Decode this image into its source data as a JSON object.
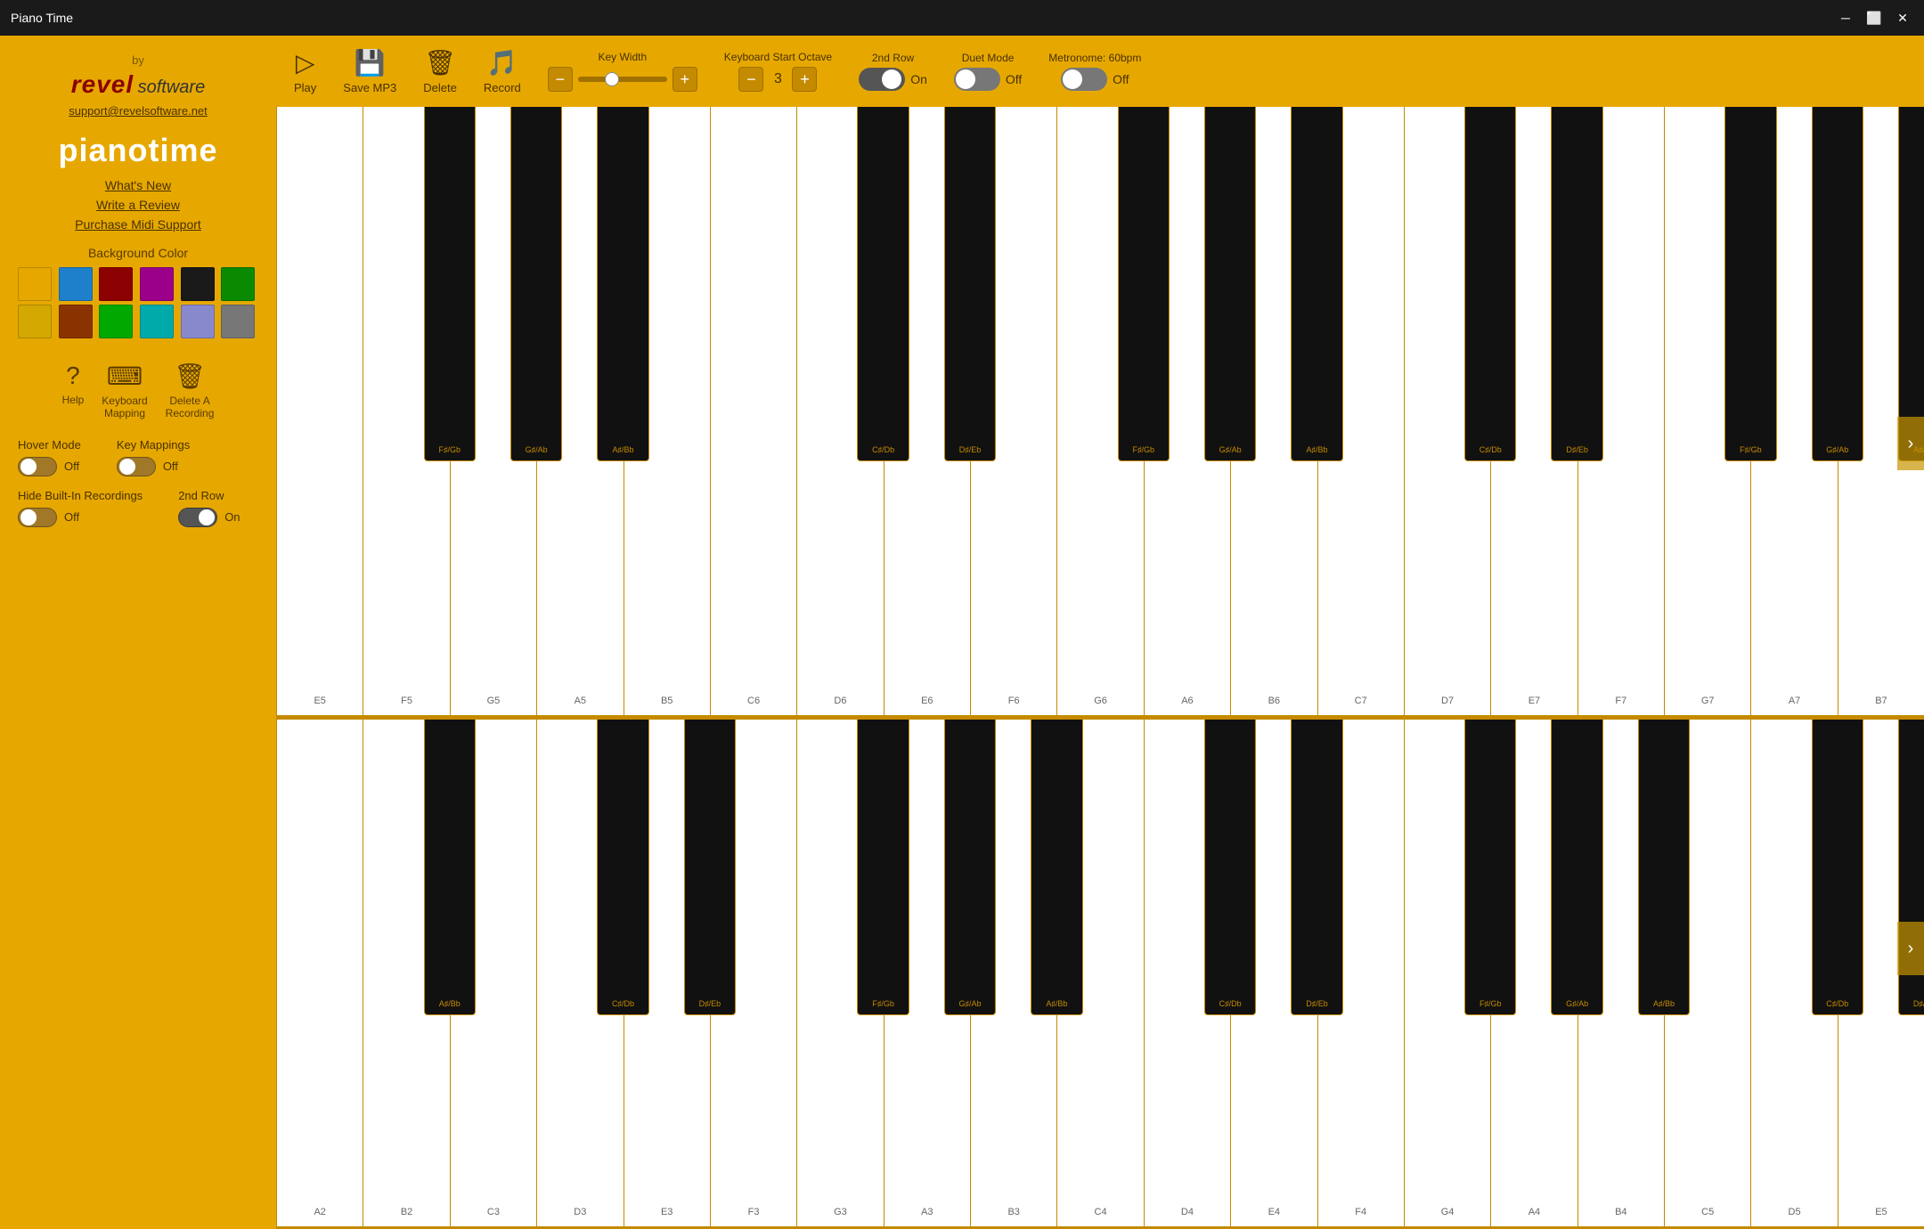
{
  "titleBar": {
    "title": "Piano Time",
    "minimizeLabel": "─",
    "maximizeLabel": "⬜",
    "closeLabel": "✕"
  },
  "sidebar": {
    "appTitle": "pianotime",
    "byLabel": "by",
    "revelLogo": "revel",
    "softwareLabel": "software",
    "email": "support@revelsoftware.net",
    "links": [
      {
        "label": "What's New"
      },
      {
        "label": "Write a Review"
      },
      {
        "label": "Purchase Midi Support"
      }
    ],
    "bgColorLabel": "Background Color",
    "colors": [
      "#E6A800",
      "#1E7FCB",
      "#8B0000",
      "#9B008B",
      "#1a1a1a",
      "#0a8a00",
      "#D4A800",
      "#8B3300",
      "#00A800",
      "#00AAAA",
      "#8888CC",
      "#777777"
    ],
    "helpLabel": "Help",
    "keyboardMappingLabel": "Keyboard\nMapping",
    "deleteRecordingLabel": "Delete A\nRecording",
    "hoverModeLabel": "Hover Mode",
    "hoverModeState": "Off",
    "hoverModeOn": false,
    "keyMappingsLabel": "Key Mappings",
    "keyMappingsState": "Off",
    "keyMappingsOn": false,
    "hideBuiltInLabel": "Hide Built-In Recordings",
    "hideBuiltInState": "Off",
    "hideBuiltInOn": false,
    "secondRowLabel": "2nd Row",
    "secondRowState": "On",
    "secondRowOn": true
  },
  "toolbar": {
    "playLabel": "Play",
    "saveMp3Label": "Save MP3",
    "deleteLabel": "Delete",
    "recordLabel": "Record",
    "keyWidthLabel": "Key Width",
    "keyboardStartOctaveLabel": "Keyboard Start Octave",
    "octaveValue": "3",
    "secondRowLabel": "2nd Row",
    "secondRowState": "On",
    "secondRowOn": true,
    "duetModeLabel": "Duet Mode",
    "duetModeState": "Off",
    "duetModeOn": false,
    "metronomeLabel": "Metronome: 60bpm",
    "metronomeState": "Off",
    "metronomeOn": false,
    "minusLabel": "−",
    "plusLabel": "+"
  },
  "piano": {
    "upperWhiteKeys": [
      "E5",
      "F5",
      "G5",
      "A5",
      "B5",
      "C6",
      "D6",
      "E6",
      "F6",
      "G6",
      "A6",
      "B6",
      "C7",
      "D7",
      "E7",
      "F7",
      "G7",
      "A7",
      "B7"
    ],
    "lowerWhiteKeys": [
      "A2",
      "B2",
      "C3",
      "D3",
      "E3",
      "F3",
      "G3",
      "A3",
      "B3",
      "C4",
      "D4",
      "E4",
      "F4",
      "G4",
      "A4",
      "B4",
      "C5",
      "D5",
      "E5"
    ],
    "upperBlackKeys": [
      {
        "label": "F♯/Gb",
        "pos": 1
      },
      {
        "label": "G♯/Ab",
        "pos": 2
      },
      {
        "label": "A♯/Bb",
        "pos": 3
      },
      {
        "label": "C♯/Db",
        "pos": 6
      },
      {
        "label": "D♯/Eb",
        "pos": 7
      },
      {
        "label": "F♯/Gb",
        "pos": 9
      },
      {
        "label": "G♯/Ab",
        "pos": 10
      },
      {
        "label": "A♯/Bb",
        "pos": 11
      },
      {
        "label": "C♯/Db",
        "pos": 13
      },
      {
        "label": "D♯/Eb",
        "pos": 14
      },
      {
        "label": "F♯/Gb",
        "pos": 16
      },
      {
        "label": "G♯/Ab",
        "pos": 17
      },
      {
        "label": "A♯/Bb",
        "pos": 18
      }
    ],
    "lowerBlackKeys": [
      {
        "label": "A♯/Bb",
        "pos": 1
      },
      {
        "label": "C♯/Db",
        "pos": 3
      },
      {
        "label": "D♯/Eb",
        "pos": 4
      },
      {
        "label": "F♯/Gb",
        "pos": 6
      },
      {
        "label": "G♯/Ab",
        "pos": 7
      },
      {
        "label": "A♯/Bb",
        "pos": 8
      },
      {
        "label": "C♯/Db",
        "pos": 10
      },
      {
        "label": "D♯/Eb",
        "pos": 11
      },
      {
        "label": "F♯/Gb",
        "pos": 13
      },
      {
        "label": "G♯/Ab",
        "pos": 14
      },
      {
        "label": "A♯/Bb",
        "pos": 15
      },
      {
        "label": "C♯/Db",
        "pos": 17
      },
      {
        "label": "D♯/Eb",
        "pos": 18
      }
    ]
  }
}
